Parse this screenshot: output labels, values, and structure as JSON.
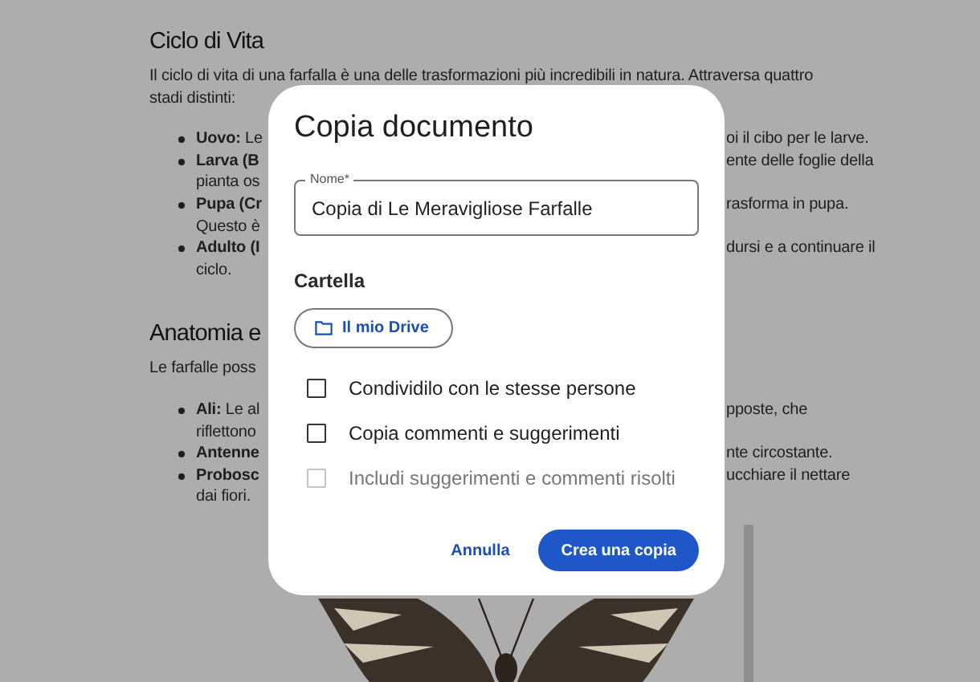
{
  "document": {
    "lines": [
      {
        "kind": "heading",
        "left": "Ciclo di Vita"
      },
      {
        "kind": "text",
        "left": "Il ciclo di vita di una farfalla è una delle trasformazioni più incredibili in natura. Attraversa quattro"
      },
      {
        "kind": "text",
        "left": "stadi distinti:"
      },
      {
        "kind": "bullet",
        "left": "**Uovo:** Le",
        "right": "oi il cibo per le larve."
      },
      {
        "kind": "bullet",
        "left": "Larva (B",
        "left_bold": true,
        "right": "ente delle foglie della"
      },
      {
        "kind": "continuation",
        "left": "pianta os"
      },
      {
        "kind": "bullet",
        "left": "Pupa (Cr",
        "left_bold": true,
        "right": "rasforma in pupa."
      },
      {
        "kind": "continuation",
        "left": "Questo è"
      },
      {
        "kind": "bullet",
        "left": "Adulto (I",
        "left_bold": true,
        "right": "dursi e a continuare il"
      },
      {
        "kind": "continuation",
        "left": "ciclo."
      },
      {
        "kind": "heading",
        "left": "Anatomia e"
      },
      {
        "kind": "text",
        "left": "Le farfalle poss"
      },
      {
        "kind": "bullet",
        "left": "**Ali:** Le al",
        "right": "pposte, che"
      },
      {
        "kind": "continuation",
        "left": "riflettono"
      },
      {
        "kind": "bullet",
        "left": "Antenne",
        "left_bold": true,
        "right": "nte circostante."
      },
      {
        "kind": "bullet",
        "left": "Probosc",
        "left_bold": true,
        "right": "ucchiare il nettare"
      },
      {
        "kind": "continuation",
        "left": "dai fiori."
      }
    ]
  },
  "dialog": {
    "title": "Copia documento",
    "name_field": {
      "label": "Nome*",
      "value": "Copia di Le Meravigliose Farfalle"
    },
    "folder_label": "Cartella",
    "folder_button": "Il mio Drive",
    "options": [
      {
        "label": "Condividilo con le stesse persone",
        "checked": false,
        "disabled": false
      },
      {
        "label": "Copia commenti e suggerimenti",
        "checked": false,
        "disabled": false
      },
      {
        "label": "Includi suggerimenti e commenti risolti",
        "checked": false,
        "disabled": true
      }
    ],
    "buttons": [
      {
        "label": "Annulla",
        "kind": "text"
      },
      {
        "label": "Crea una copia",
        "kind": "filled"
      }
    ]
  }
}
